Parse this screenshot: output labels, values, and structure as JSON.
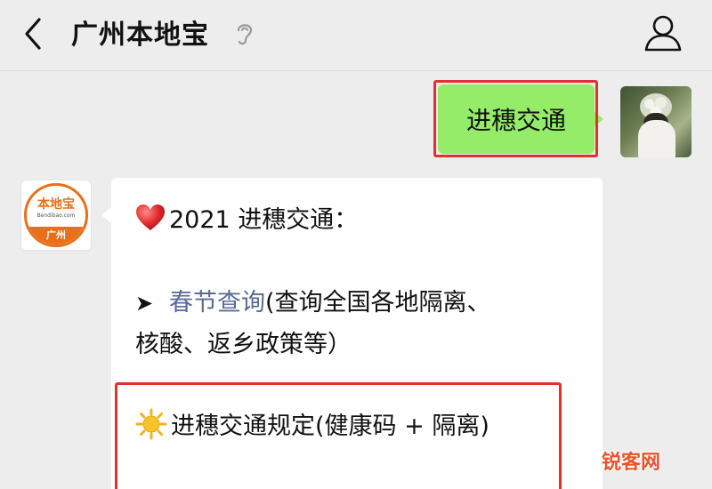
{
  "header": {
    "title": "广州本地宝"
  },
  "chat": {
    "outgoing": {
      "text": "进穗交通"
    },
    "bot_avatar": {
      "logo_text": "本地宝",
      "logo_sub": "Bendibao.com",
      "city": "广州"
    },
    "incoming": {
      "line1": "2021 进穗交通：",
      "line2_link": "春节查询",
      "line2_rest": "(查询全国各地隔离、",
      "line3": "核酸、返乡政策等）",
      "line4": "进穗交通规定(健康码 + 隔离)"
    }
  },
  "watermark": "锐客网",
  "icons": {
    "back": "chevron-left-icon",
    "ear": "ear-icon",
    "profile": "person-icon",
    "heart": "heart-icon",
    "arrow": "arrow-right-icon",
    "sun": "sun-icon"
  },
  "colors": {
    "background": "#ededed",
    "outgoing_bubble": "#95ec69",
    "incoming_bubble": "#ffffff",
    "link": "#576b95",
    "highlight": "#e0312e",
    "brand_orange": "#e8701a"
  }
}
